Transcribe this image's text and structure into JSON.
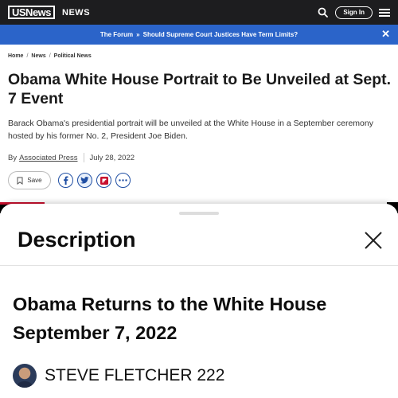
{
  "header": {
    "logo": "USNews",
    "section": "NEWS",
    "signin_label": "Sign In"
  },
  "forum": {
    "label": "The Forum",
    "chevron": "»",
    "topic": "Should Supreme Court Justices Have Term Limits?"
  },
  "breadcrumb": [
    "Home",
    "News",
    "Political News"
  ],
  "article": {
    "headline": "Obama White House Portrait to Be Unveiled at Sept. 7 Event",
    "summary": "Barack Obama's presidential portrait will be unveiled at the White House in a September ceremony hosted by his former No. 2, President Joe Biden.",
    "by": "By",
    "author": "Associated Press",
    "date": "July 28, 2022",
    "save_label": "Save"
  },
  "share_icons": [
    "facebook-icon",
    "twitter-icon",
    "flipboard-icon",
    "more-icon"
  ],
  "sheet": {
    "title": "Description",
    "video_title": "Obama Returns to the White House September 7, 2022",
    "channel_name": "STEVE FLETCHER 222"
  },
  "colors": {
    "topbar": "#1d1d1f",
    "forum_banner": "#2b64c9",
    "accent_red": "#c8102e",
    "share_blue": "#1f4ea3"
  }
}
